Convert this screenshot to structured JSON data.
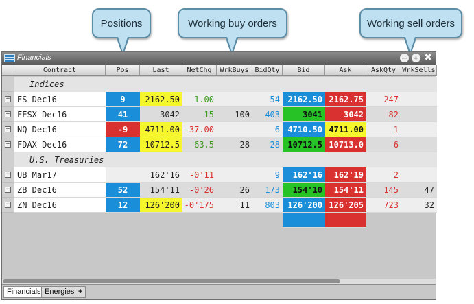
{
  "callouts": {
    "positions": "Positions",
    "buy": "Working buy orders",
    "sell": "Working sell orders"
  },
  "window": {
    "title": "Financials",
    "minimize": "−",
    "maximize": "+",
    "close": "✖"
  },
  "columns": [
    "Contract",
    "Pos",
    "Last",
    "NetChg",
    "WrkBuys",
    "BidQty",
    "Bid",
    "Ask",
    "AskQty",
    "WrkSells"
  ],
  "colors": {
    "blue": "#1a8ed8",
    "red": "#d93030",
    "green": "#26c226",
    "yellow": "#f6f62e",
    "text_blue": "#1a8ed8",
    "text_red": "#d93030",
    "text_green": "#3a9c1a"
  },
  "sections": [
    {
      "label": "Indices",
      "rows": [
        {
          "contract": "ES Dec16",
          "pos": "9",
          "last": "2162.50",
          "netchg": "1.00",
          "wrkbuys": "",
          "bidqty": "54",
          "bid": "2162.50",
          "ask": "2162.75",
          "askqty": "247",
          "wrksells": "",
          "pos_bg": "blue",
          "last_bg": "yellow",
          "netchg_fg": "text_green",
          "bid_bg": "blue",
          "ask_bg": "red"
        },
        {
          "contract": "FESX Dec16",
          "pos": "41",
          "last": "3042",
          "netchg": "15",
          "wrkbuys": "100",
          "bidqty": "403",
          "bid": "3041",
          "ask": "3042",
          "askqty": "82",
          "wrksells": "",
          "pos_bg": "blue",
          "last_bg": "",
          "netchg_fg": "text_green",
          "bid_bg": "green",
          "ask_bg": "red"
        },
        {
          "contract": "NQ Dec16",
          "pos": "-9",
          "last": "4711.00",
          "netchg": "-37.00",
          "wrkbuys": "",
          "bidqty": "6",
          "bid": "4710.50",
          "ask": "4711.00",
          "askqty": "1",
          "wrksells": "",
          "pos_bg": "red",
          "last_bg": "yellow",
          "netchg_fg": "text_red",
          "bid_bg": "blue",
          "ask_bg": "yellow"
        },
        {
          "contract": "FDAX Dec16",
          "pos": "72",
          "last": "10712.5",
          "netchg": "63.5",
          "wrkbuys": "28",
          "bidqty": "28",
          "bid": "10712.5",
          "ask": "10713.0",
          "askqty": "6",
          "wrksells": "",
          "pos_bg": "blue",
          "last_bg": "yellow",
          "netchg_fg": "text_green",
          "bid_bg": "green",
          "ask_bg": "red"
        }
      ]
    },
    {
      "label": "U.S. Treasuries",
      "rows": [
        {
          "contract": "UB Mar17",
          "pos": "",
          "last": "162'16",
          "netchg": "-0'11",
          "wrkbuys": "",
          "bidqty": "9",
          "bid": "162'16",
          "ask": "162'19",
          "askqty": "2",
          "wrksells": "",
          "pos_bg": "",
          "last_bg": "",
          "netchg_fg": "text_red",
          "bid_bg": "blue",
          "ask_bg": "red"
        },
        {
          "contract": "ZB Dec16",
          "pos": "52",
          "last": "154'11",
          "netchg": "-0'26",
          "wrkbuys": "26",
          "bidqty": "173",
          "bid": "154'10",
          "ask": "154'11",
          "askqty": "145",
          "wrksells": "47",
          "pos_bg": "blue",
          "last_bg": "",
          "netchg_fg": "text_red",
          "bid_bg": "green",
          "ask_bg": "red"
        },
        {
          "contract": "ZN Dec16",
          "pos": "12",
          "last": "126'200",
          "netchg": "-0'175",
          "wrkbuys": "11",
          "bidqty": "803",
          "bid": "126'200",
          "ask": "126'205",
          "askqty": "723",
          "wrksells": "32",
          "pos_bg": "blue",
          "last_bg": "yellow",
          "netchg_fg": "text_red",
          "bid_bg": "blue",
          "ask_bg": "red"
        }
      ]
    }
  ],
  "tabs": [
    "Financials",
    "Energies"
  ],
  "add_tab": "+"
}
